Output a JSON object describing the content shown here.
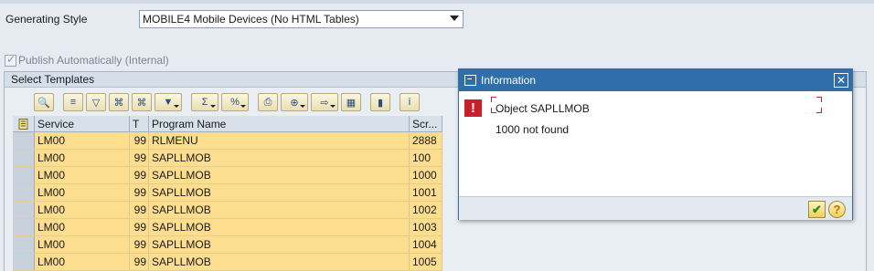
{
  "form": {
    "generating_style_label": "Generating Style",
    "generating_style_value": "MOBILE4 Mobile Devices (No HTML Tables)",
    "publish_label": "Publish Automatically (Internal)"
  },
  "group": {
    "title": "Select Templates"
  },
  "toolbar": {
    "icons": [
      "details-icon",
      "sort-ascending-icon",
      "filter-icon",
      "find-icon",
      "find-next-icon",
      "set-filter-icon",
      "sum-icon",
      "subtotals-icon",
      "print-icon",
      "export-icon",
      "view-icon",
      "layout-grid-icon",
      "chart-icon",
      "info-icon"
    ]
  },
  "table": {
    "columns": [
      "Service",
      "T",
      "Program Name",
      "Scr..."
    ],
    "rows": [
      [
        "LM00",
        "99",
        "RLMENU",
        "2888"
      ],
      [
        "LM00",
        "99",
        "SAPLLMOB",
        "100"
      ],
      [
        "LM00",
        "99",
        "SAPLLMOB",
        "1000"
      ],
      [
        "LM00",
        "99",
        "SAPLLMOB",
        "1001"
      ],
      [
        "LM00",
        "99",
        "SAPLLMOB",
        "1002"
      ],
      [
        "LM00",
        "99",
        "SAPLLMOB",
        "1003"
      ],
      [
        "LM00",
        "99",
        "SAPLLMOB",
        "1004"
      ],
      [
        "LM00",
        "99",
        "SAPLLMOB",
        "1005"
      ]
    ]
  },
  "dialog": {
    "title": "Information",
    "close_glyph": "✕",
    "message_line1": "Object SAPLLMOB",
    "message_line2": "1000 not found",
    "ok_glyph": "✔",
    "help_glyph": "?"
  },
  "colors": {
    "row_highlight": "#fdde8e",
    "dialog_titlebar": "#2f6ea8",
    "error_icon": "#c8202a"
  }
}
